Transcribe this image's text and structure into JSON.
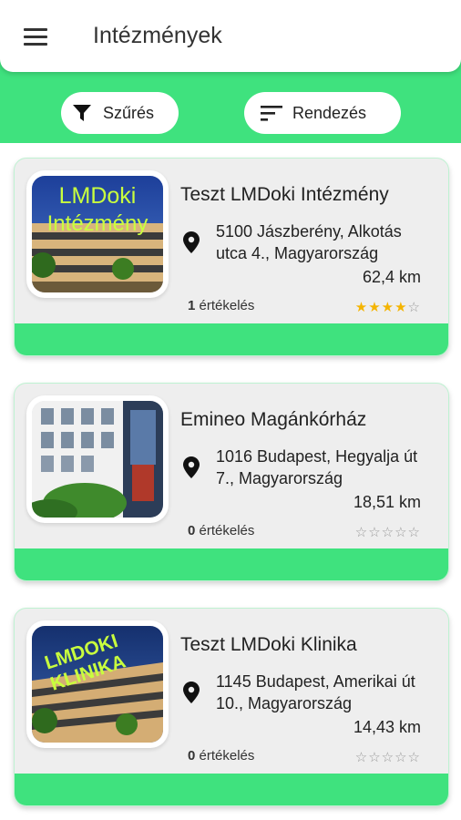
{
  "appbar": {
    "title": "Intézmények",
    "menu_icon": "menu-icon"
  },
  "filters": {
    "filter_label": "Szűrés",
    "filter_icon": "funnel-icon",
    "sort_label": "Rendezés",
    "sort_icon": "sort-icon"
  },
  "colors": {
    "accent": "#3fe27e",
    "star": "#f4b400",
    "card_bg": "#eeeeee"
  },
  "institutions": [
    {
      "name": "Teszt LMDoki Intézmény",
      "address": "5100 Jászberény, Alkotás utca 4., Magyarország",
      "distance": "62,4 km",
      "review_count": "1",
      "review_label": "értékelés",
      "rating": 4,
      "image": "Teszt LMDoki Intézmény photo",
      "image_text": [
        "LMDoki",
        "Intézmény"
      ]
    },
    {
      "name": "Emineo Magánkórház",
      "address": "1016 Budapest, Hegyalja út 7., Magyarország",
      "distance": "18,51 km",
      "review_count": "0",
      "review_label": "értékelés",
      "rating": 0,
      "image": "Emineo Magánkórház photo",
      "image_text": []
    },
    {
      "name": "Teszt LMDoki Klinika",
      "address": "1145 Budapest, Amerikai út 10., Magyarország",
      "distance": "14,43 km",
      "review_count": "0",
      "review_label": "értékelés",
      "rating": 0,
      "image": "Teszt LMDoki Klinika photo",
      "image_text": [
        "LMDOKI",
        "KLINIKA"
      ]
    }
  ]
}
